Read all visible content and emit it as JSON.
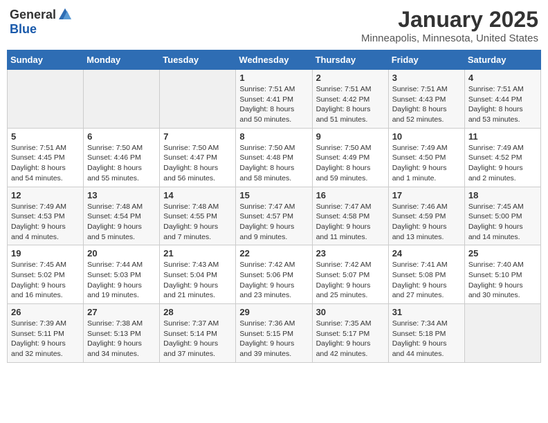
{
  "header": {
    "logo_general": "General",
    "logo_blue": "Blue",
    "month": "January 2025",
    "location": "Minneapolis, Minnesota, United States"
  },
  "weekdays": [
    "Sunday",
    "Monday",
    "Tuesday",
    "Wednesday",
    "Thursday",
    "Friday",
    "Saturday"
  ],
  "weeks": [
    [
      {
        "day": "",
        "info": ""
      },
      {
        "day": "",
        "info": ""
      },
      {
        "day": "",
        "info": ""
      },
      {
        "day": "1",
        "info": "Sunrise: 7:51 AM\nSunset: 4:41 PM\nDaylight: 8 hours\nand 50 minutes."
      },
      {
        "day": "2",
        "info": "Sunrise: 7:51 AM\nSunset: 4:42 PM\nDaylight: 8 hours\nand 51 minutes."
      },
      {
        "day": "3",
        "info": "Sunrise: 7:51 AM\nSunset: 4:43 PM\nDaylight: 8 hours\nand 52 minutes."
      },
      {
        "day": "4",
        "info": "Sunrise: 7:51 AM\nSunset: 4:44 PM\nDaylight: 8 hours\nand 53 minutes."
      }
    ],
    [
      {
        "day": "5",
        "info": "Sunrise: 7:51 AM\nSunset: 4:45 PM\nDaylight: 8 hours\nand 54 minutes."
      },
      {
        "day": "6",
        "info": "Sunrise: 7:50 AM\nSunset: 4:46 PM\nDaylight: 8 hours\nand 55 minutes."
      },
      {
        "day": "7",
        "info": "Sunrise: 7:50 AM\nSunset: 4:47 PM\nDaylight: 8 hours\nand 56 minutes."
      },
      {
        "day": "8",
        "info": "Sunrise: 7:50 AM\nSunset: 4:48 PM\nDaylight: 8 hours\nand 58 minutes."
      },
      {
        "day": "9",
        "info": "Sunrise: 7:50 AM\nSunset: 4:49 PM\nDaylight: 8 hours\nand 59 minutes."
      },
      {
        "day": "10",
        "info": "Sunrise: 7:49 AM\nSunset: 4:50 PM\nDaylight: 9 hours\nand 1 minute."
      },
      {
        "day": "11",
        "info": "Sunrise: 7:49 AM\nSunset: 4:52 PM\nDaylight: 9 hours\nand 2 minutes."
      }
    ],
    [
      {
        "day": "12",
        "info": "Sunrise: 7:49 AM\nSunset: 4:53 PM\nDaylight: 9 hours\nand 4 minutes."
      },
      {
        "day": "13",
        "info": "Sunrise: 7:48 AM\nSunset: 4:54 PM\nDaylight: 9 hours\nand 5 minutes."
      },
      {
        "day": "14",
        "info": "Sunrise: 7:48 AM\nSunset: 4:55 PM\nDaylight: 9 hours\nand 7 minutes."
      },
      {
        "day": "15",
        "info": "Sunrise: 7:47 AM\nSunset: 4:57 PM\nDaylight: 9 hours\nand 9 minutes."
      },
      {
        "day": "16",
        "info": "Sunrise: 7:47 AM\nSunset: 4:58 PM\nDaylight: 9 hours\nand 11 minutes."
      },
      {
        "day": "17",
        "info": "Sunrise: 7:46 AM\nSunset: 4:59 PM\nDaylight: 9 hours\nand 13 minutes."
      },
      {
        "day": "18",
        "info": "Sunrise: 7:45 AM\nSunset: 5:00 PM\nDaylight: 9 hours\nand 14 minutes."
      }
    ],
    [
      {
        "day": "19",
        "info": "Sunrise: 7:45 AM\nSunset: 5:02 PM\nDaylight: 9 hours\nand 16 minutes."
      },
      {
        "day": "20",
        "info": "Sunrise: 7:44 AM\nSunset: 5:03 PM\nDaylight: 9 hours\nand 19 minutes."
      },
      {
        "day": "21",
        "info": "Sunrise: 7:43 AM\nSunset: 5:04 PM\nDaylight: 9 hours\nand 21 minutes."
      },
      {
        "day": "22",
        "info": "Sunrise: 7:42 AM\nSunset: 5:06 PM\nDaylight: 9 hours\nand 23 minutes."
      },
      {
        "day": "23",
        "info": "Sunrise: 7:42 AM\nSunset: 5:07 PM\nDaylight: 9 hours\nand 25 minutes."
      },
      {
        "day": "24",
        "info": "Sunrise: 7:41 AM\nSunset: 5:08 PM\nDaylight: 9 hours\nand 27 minutes."
      },
      {
        "day": "25",
        "info": "Sunrise: 7:40 AM\nSunset: 5:10 PM\nDaylight: 9 hours\nand 30 minutes."
      }
    ],
    [
      {
        "day": "26",
        "info": "Sunrise: 7:39 AM\nSunset: 5:11 PM\nDaylight: 9 hours\nand 32 minutes."
      },
      {
        "day": "27",
        "info": "Sunrise: 7:38 AM\nSunset: 5:13 PM\nDaylight: 9 hours\nand 34 minutes."
      },
      {
        "day": "28",
        "info": "Sunrise: 7:37 AM\nSunset: 5:14 PM\nDaylight: 9 hours\nand 37 minutes."
      },
      {
        "day": "29",
        "info": "Sunrise: 7:36 AM\nSunset: 5:15 PM\nDaylight: 9 hours\nand 39 minutes."
      },
      {
        "day": "30",
        "info": "Sunrise: 7:35 AM\nSunset: 5:17 PM\nDaylight: 9 hours\nand 42 minutes."
      },
      {
        "day": "31",
        "info": "Sunrise: 7:34 AM\nSunset: 5:18 PM\nDaylight: 9 hours\nand 44 minutes."
      },
      {
        "day": "",
        "info": ""
      }
    ]
  ]
}
